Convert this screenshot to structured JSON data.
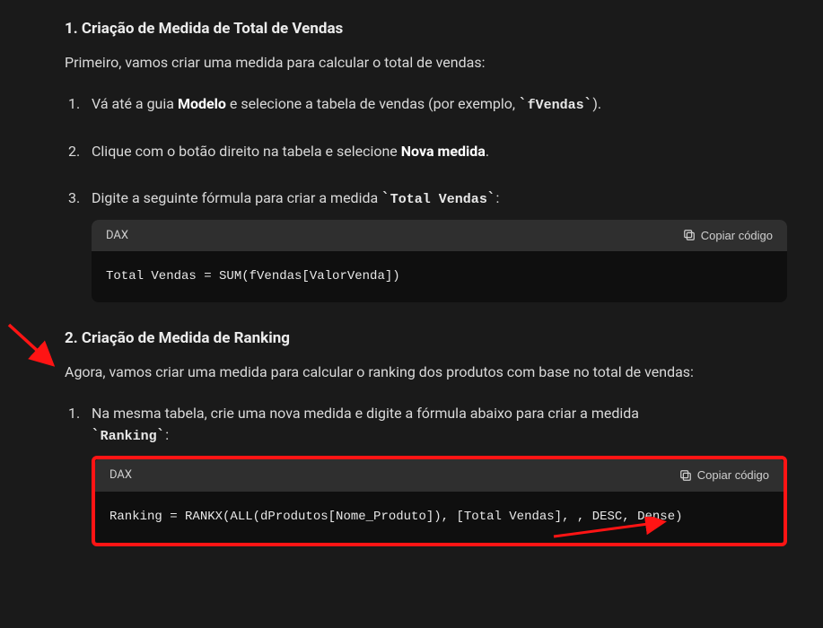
{
  "section1": {
    "number": "1.",
    "title": "Criação de Medida de Total de Vendas",
    "intro": "Primeiro, vamos criar uma medida para calcular o total de vendas:",
    "steps": {
      "s1_num": "1.",
      "s1_pre": "Vá até a guia ",
      "s1_bold": "Modelo",
      "s1_mid": " e selecione a tabela de vendas (por exemplo, ",
      "s1_code": "fVendas",
      "s1_post": ").",
      "s2_num": "2.",
      "s2_pre": "Clique com o botão direito na tabela e selecione ",
      "s2_bold": "Nova medida",
      "s2_post": ".",
      "s3_num": "3.",
      "s3_pre": "Digite a seguinte fórmula para criar a medida ",
      "s3_code": "Total Vendas",
      "s3_post": ":"
    },
    "code": {
      "lang": "DAX",
      "copy_label": "Copiar código",
      "body": "Total Vendas = SUM(fVendas[ValorVenda])"
    }
  },
  "section2": {
    "number": "2.",
    "title": "Criação de Medida de Ranking",
    "intro": "Agora, vamos criar uma medida para calcular o ranking dos produtos com base no total de vendas:",
    "steps": {
      "s1_num": "1.",
      "s1_text": "Na mesma tabela, crie uma nova medida e digite a fórmula abaixo para criar a medida",
      "s1_code": "Ranking",
      "s1_post": ":"
    },
    "code": {
      "lang": "DAX",
      "copy_label": "Copiar código",
      "body": "Ranking = RANKX(ALL(dProdutos[Nome_Produto]), [Total Vendas], , DESC, Dense)"
    }
  },
  "backtick": "`"
}
